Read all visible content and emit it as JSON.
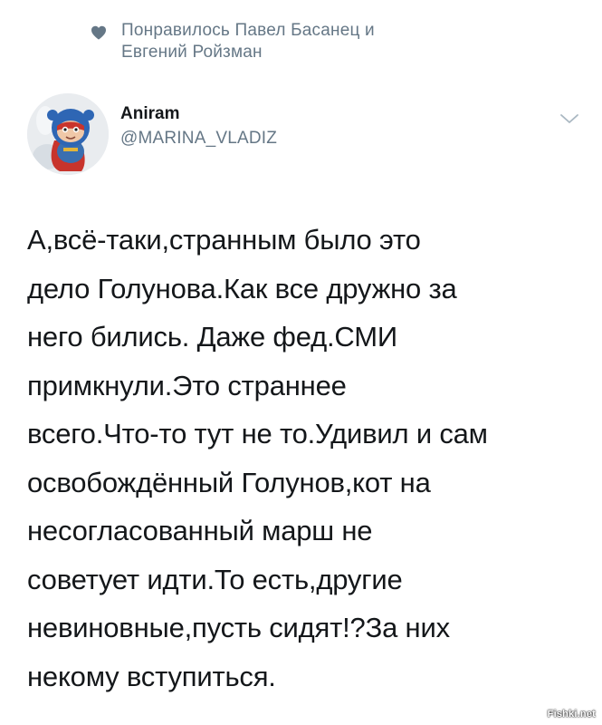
{
  "social_context": {
    "icon": "heart-icon",
    "text": "Понравилось Павел Басанец и\nЕвгений Ройзман"
  },
  "author": {
    "name": "Aniram",
    "handle": "@MARINA_VLADIZ"
  },
  "tweet": {
    "text": "А,всё-таки,странным было это\nдело Голунова.Как все дружно за\nнего бились. Даже фед.СМИ\nпримкнули.Это страннее\nвсего.Что-то тут не то.Удивил и сам\nосвобождённый Голунов,кот  на\nнесогласованный марш не\nсоветует идти.То есть,другие\nневиновные,пусть сидят!?За них\nнекому вступиться."
  },
  "watermark": "Fishki.net",
  "colors": {
    "text_primary": "#14171a",
    "text_secondary": "#657786",
    "icon_gray": "#657786"
  }
}
